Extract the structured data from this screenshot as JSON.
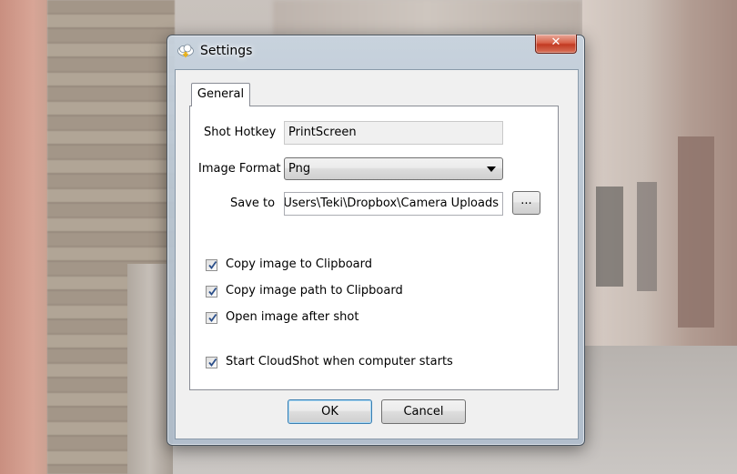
{
  "window": {
    "title": "Settings",
    "close_label": "✕"
  },
  "tabs": [
    {
      "label": "General",
      "selected": true
    }
  ],
  "general": {
    "hotkey_label": "Shot Hotkey",
    "hotkey_value": "PrintScreen",
    "format_label": "Image Format",
    "format_value": "Png",
    "saveto_label": "Save to",
    "saveto_value": "C:\\Users\\Teki\\Dropbox\\Camera Uploads",
    "browse_label": "...",
    "checkboxes": [
      {
        "label": "Copy image to Clipboard",
        "checked": true
      },
      {
        "label": "Copy image path to Clipboard",
        "checked": true
      },
      {
        "label": "Open image after shot",
        "checked": true
      },
      {
        "label": "Start CloudShot when computer starts",
        "checked": true
      }
    ]
  },
  "buttons": {
    "ok_label": "OK",
    "cancel_label": "Cancel"
  },
  "colors": {
    "check_mark": "#2b4f8a",
    "close_button": "#c23a22"
  }
}
